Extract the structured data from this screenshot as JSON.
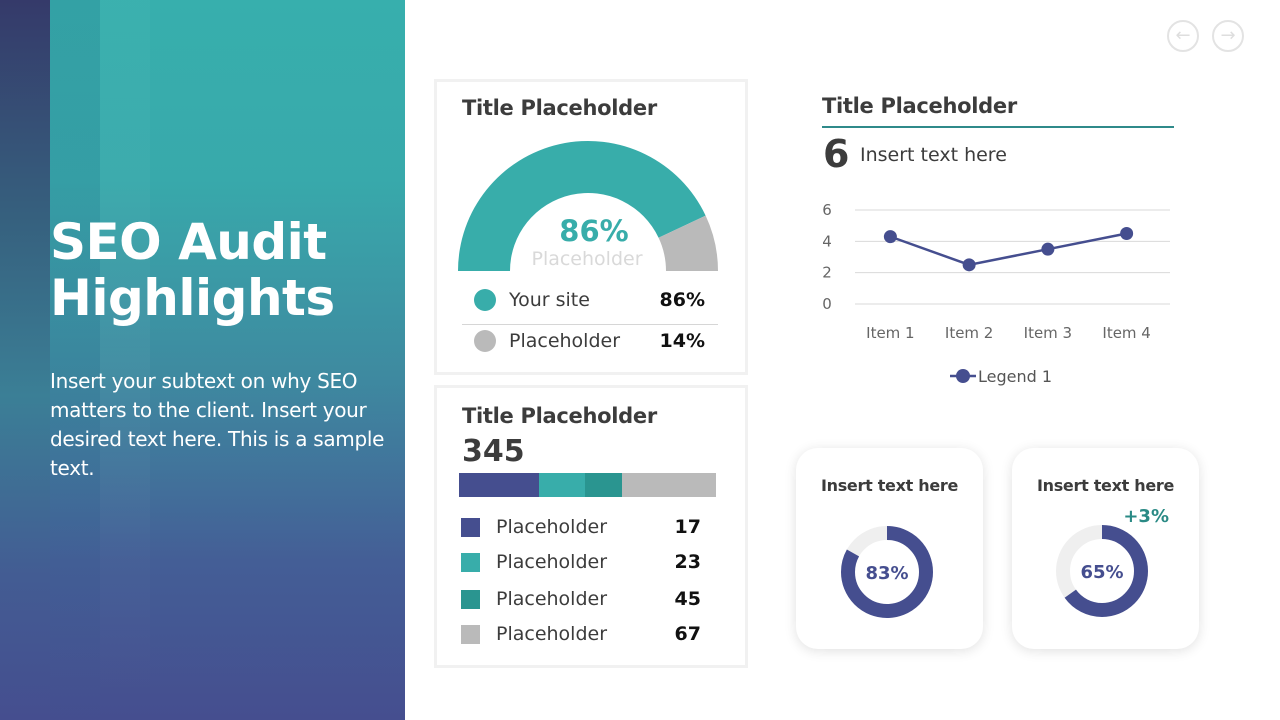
{
  "colors": {
    "teal": "#38adaa",
    "dark_teal": "#2a9590",
    "indigo": "#454e8f",
    "gray": "#bababa",
    "track": "#efefef",
    "delta_green": "#2a8a85"
  },
  "navigation": {
    "prev_icon": "arrow-left-circle-icon",
    "next_icon": "arrow-right-circle-icon",
    "prev_glyph": "←",
    "next_glyph": "→"
  },
  "hero": {
    "title_line1": "SEO Audit",
    "title_line2": "Highlights",
    "subtext": "Insert your subtext on why SEO matters to the client. Insert your desired text here. This is a sample text."
  },
  "gauge_card": {
    "title": "Title Placeholder",
    "center_value": "86%",
    "center_label": "Placeholder",
    "legend": [
      {
        "label": "Your site",
        "value": "86%",
        "color": "#38adaa"
      },
      {
        "label": "Placeholder",
        "value": "14%",
        "color": "#bababa"
      }
    ]
  },
  "bar_card": {
    "title": "Title Placeholder",
    "total": "345",
    "stack_shares": [
      0.31,
      0.18,
      0.145,
      0.365
    ],
    "items": [
      {
        "label": "Placeholder",
        "value": "17",
        "color": "#454e8f"
      },
      {
        "label": "Placeholder",
        "value": "23",
        "color": "#38adaa"
      },
      {
        "label": "Placeholder",
        "value": "45",
        "color": "#2a9590"
      },
      {
        "label": "Placeholder",
        "value": "67",
        "color": "#bababa"
      }
    ]
  },
  "line_card": {
    "title": "Title Placeholder",
    "big_number": "6",
    "big_number_text": "Insert text here"
  },
  "donut_cards": [
    {
      "title": "Insert text here",
      "percent": 83,
      "label": "83%",
      "delta": ""
    },
    {
      "title": "Insert text here",
      "percent": 65,
      "label": "65%",
      "delta": "+3%"
    }
  ],
  "chart_data": [
    {
      "type": "pie",
      "title": "Title Placeholder",
      "style": "half-donut gauge",
      "categories": [
        "Your site",
        "Placeholder"
      ],
      "values": [
        86,
        14
      ],
      "center_label": "86%"
    },
    {
      "type": "bar",
      "title": "Title Placeholder",
      "style": "stacked horizontal",
      "total": 345,
      "categories": [
        "Placeholder",
        "Placeholder",
        "Placeholder",
        "Placeholder"
      ],
      "values": [
        17,
        23,
        45,
        67
      ]
    },
    {
      "type": "line",
      "title": "Title Placeholder",
      "categories": [
        "Item 1",
        "Item 2",
        "Item 3",
        "Item 4"
      ],
      "series": [
        {
          "name": "Legend 1",
          "values": [
            4.3,
            2.5,
            3.5,
            4.5
          ]
        }
      ],
      "ylim": [
        0,
        6
      ],
      "yticks": [
        0,
        2,
        4,
        6
      ],
      "grid": true,
      "legend": "bottom",
      "xlabel": "",
      "ylabel": ""
    },
    {
      "type": "pie",
      "title": "Insert text here",
      "style": "donut",
      "values": [
        83,
        17
      ],
      "center_label": "83%"
    },
    {
      "type": "pie",
      "title": "Insert text here",
      "style": "donut",
      "values": [
        65,
        35
      ],
      "center_label": "65%",
      "annotation": "+3%"
    }
  ]
}
